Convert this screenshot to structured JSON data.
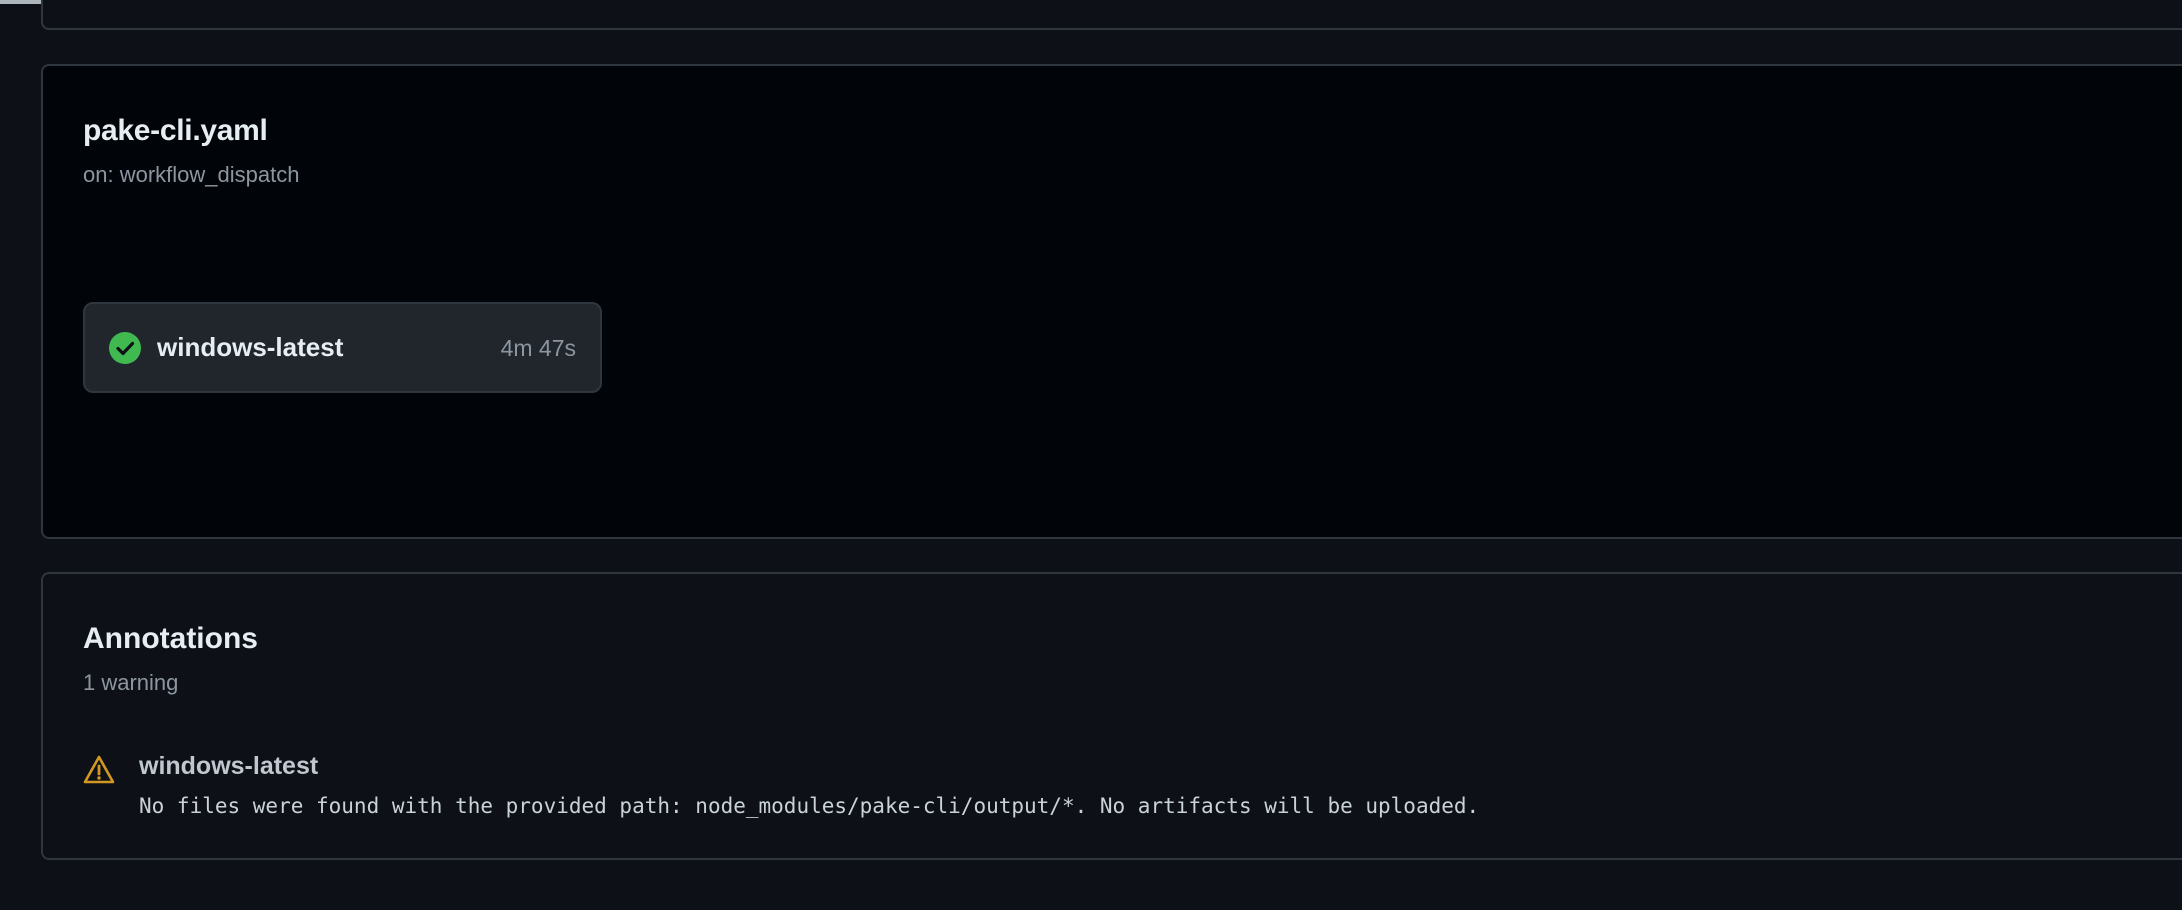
{
  "workflow": {
    "file_name": "pake-cli.yaml",
    "trigger": "on: workflow_dispatch",
    "jobs": [
      {
        "name": "windows-latest",
        "duration": "4m 47s",
        "status": "success",
        "status_color": "#3fb950"
      }
    ]
  },
  "annotations": {
    "title": "Annotations",
    "count_label": "1 warning",
    "items": [
      {
        "level": "warning",
        "icon": "alert-triangle-icon",
        "color": "#d29922",
        "job": "windows-latest",
        "message": "No files were found with the provided path: node_modules/pake-cli/output/*. No artifacts will be uploaded."
      }
    ]
  },
  "theme": {
    "background": "#0d1117",
    "panel_border": "#30363d",
    "success": "#3fb950",
    "warning": "#d29922"
  }
}
